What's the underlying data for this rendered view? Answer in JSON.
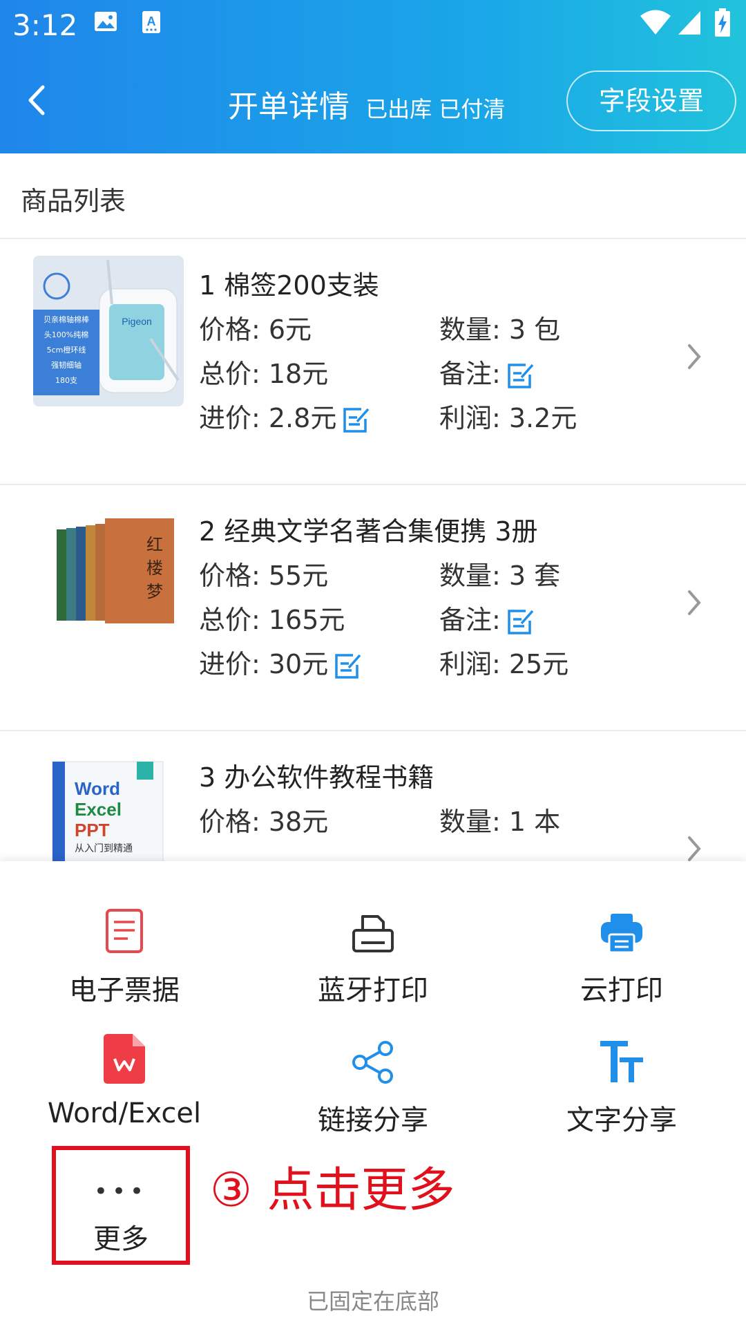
{
  "status": {
    "time": "3:12"
  },
  "header": {
    "title": "开单详情",
    "subtitle": "已出库  已付清",
    "field_settings": "字段设置"
  },
  "section": {
    "title": "商品列表"
  },
  "items": [
    {
      "name": "1 棉签200支装",
      "price": "价格: 6元",
      "qty": "数量: 3 包",
      "total": "总价: 18元",
      "remark": "备注:",
      "cost": "进价: 2.8元",
      "profit": "利润: 3.2元",
      "thumb_text": [
        "贝亲棉轴棉棒",
        "头100%纯棉",
        "5cm橙环线",
        "强韧细轴",
        "180支"
      ],
      "brand": "Pigeon"
    },
    {
      "name": "2 经典文学名著合集便携 3册",
      "price": "价格: 55元",
      "qty": "数量: 3 套",
      "total": "总价: 165元",
      "remark": "备注:",
      "cost": "进价: 30元",
      "profit": "利润: 25元",
      "thumb_text": [
        "红",
        "楼",
        "梦"
      ]
    },
    {
      "name": "3 办公软件教程书籍",
      "price": "价格: 38元",
      "qty": "数量: 1 本",
      "thumb_text": [
        "Word",
        "Excel",
        "PPT",
        "从入门到精通"
      ]
    }
  ],
  "actions": [
    {
      "label": "电子票据",
      "icon": "receipt-icon"
    },
    {
      "label": "蓝牙打印",
      "icon": "bluetooth-printer-icon"
    },
    {
      "label": "云打印",
      "icon": "cloud-printer-icon"
    },
    {
      "label": "Word/Excel",
      "icon": "wps-file-icon"
    },
    {
      "label": "链接分享",
      "icon": "share-link-icon"
    },
    {
      "label": "文字分享",
      "icon": "text-share-icon"
    }
  ],
  "more": {
    "label": "更多",
    "dots": "•••"
  },
  "annotation": "③ 点击更多",
  "footer": {
    "pinned": "已固定在底部"
  },
  "colors": {
    "accent": "#1f8fea",
    "annotation": "#e0101d",
    "edit_icon": "#1f8fea"
  }
}
